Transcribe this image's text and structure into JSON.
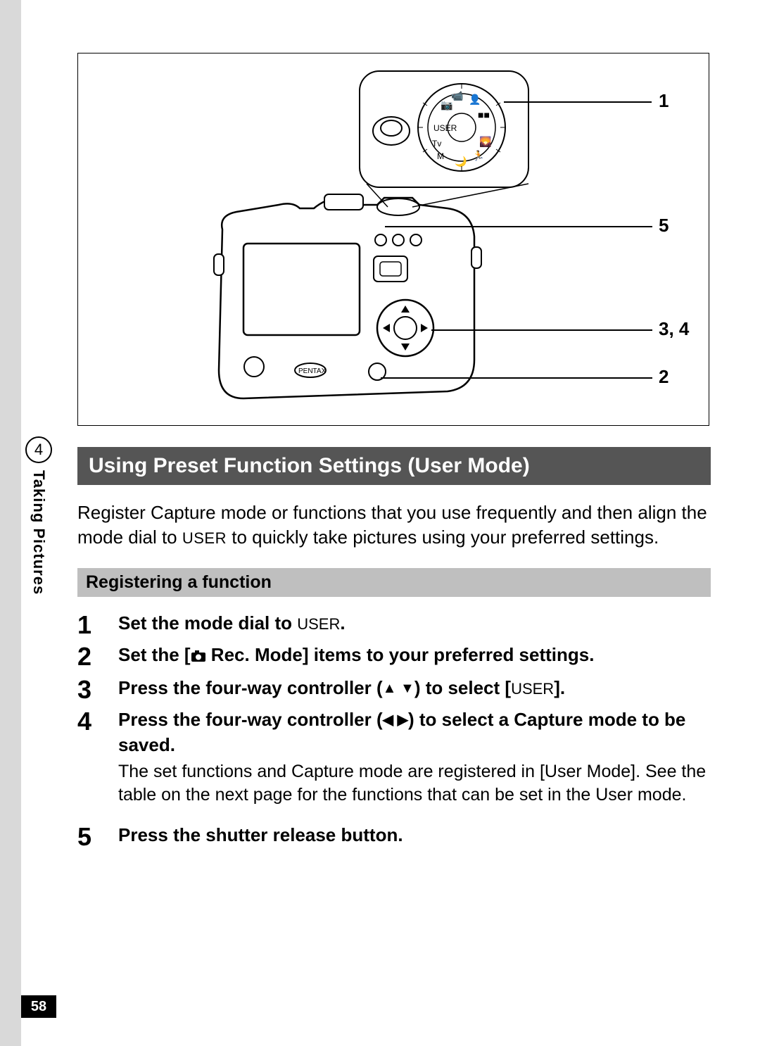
{
  "page_number": "58",
  "chapter": {
    "number": "4",
    "label": "Taking Pictures"
  },
  "diagram": {
    "callouts": [
      "1",
      "5",
      "3, 4",
      "2"
    ]
  },
  "title": "Using Preset Function Settings (User Mode)",
  "intro_parts": {
    "a": "Register Capture mode or functions that you use frequently and then align the mode dial to ",
    "user_text": "USER",
    "b": " to quickly take pictures using your preferred settings."
  },
  "subheading": "Registering a function",
  "steps": [
    {
      "num": "1",
      "parts": {
        "a": "Set the mode dial to ",
        "user": "USER",
        "b": "."
      }
    },
    {
      "num": "2",
      "parts": {
        "a": "Set the [",
        "b": " Rec. Mode] items to your preferred settings."
      }
    },
    {
      "num": "3",
      "parts": {
        "a": "Press the four-way controller (",
        "b": ") to select [",
        "user": "USER",
        "c": "]."
      }
    },
    {
      "num": "4",
      "text": "Press the four-way controller (◀ ▶) to select a Capture mode to be saved.",
      "parts": {
        "a": "Press the four-way controller (",
        "b": ") to select a Capture mode to be saved."
      },
      "note": "The set functions and Capture mode are registered in [User Mode]. See the table on the next page for the functions that can be set in the User mode."
    },
    {
      "num": "5",
      "text": "Press the shutter release button."
    }
  ]
}
